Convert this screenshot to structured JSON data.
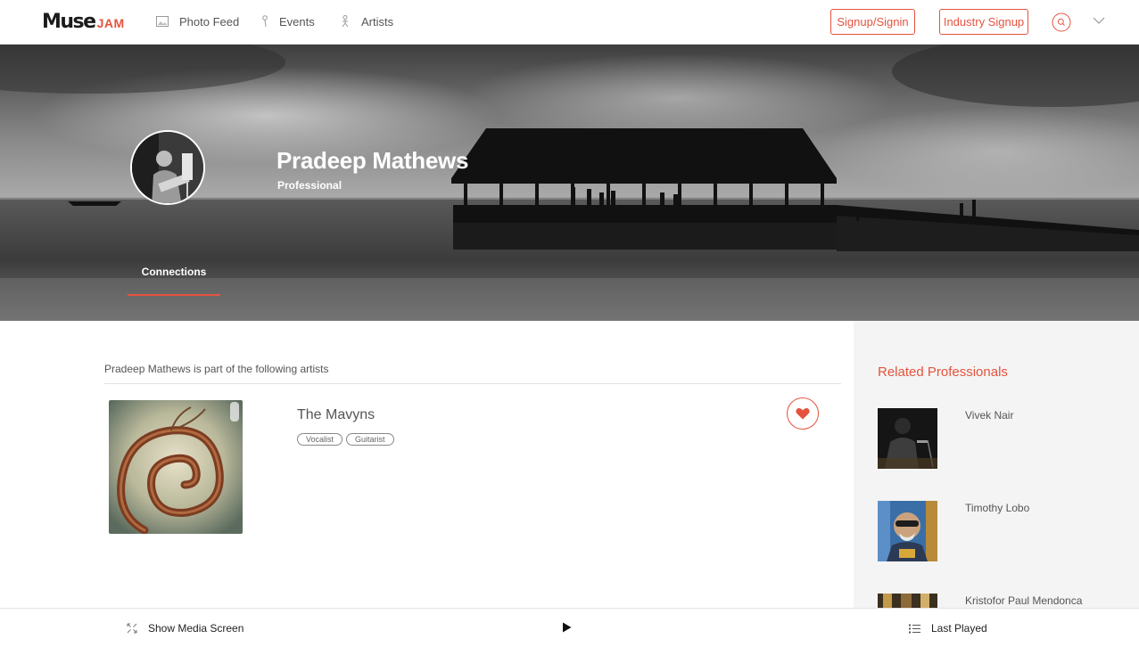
{
  "brand": {
    "muse": "Muse",
    "jam": "JAM",
    "accent": "#e5533d"
  },
  "nav": {
    "links": [
      {
        "label": "Photo Feed",
        "icon": "photo-icon"
      },
      {
        "label": "Events",
        "icon": "microphone-icon"
      },
      {
        "label": "Artists",
        "icon": "artist-icon"
      }
    ],
    "signup_signin": "Signup/Signin",
    "industry_signup": "Industry Signup",
    "search_icon": "search-icon",
    "menu_icon": "chevron-down-icon"
  },
  "profile": {
    "name": "Pradeep Mathews",
    "role": "Professional",
    "tabs": [
      {
        "label": "Connections",
        "active": true
      }
    ]
  },
  "main": {
    "heading": "Pradeep Mathews is part of the following artists",
    "artists": [
      {
        "name": "The Mavyns",
        "tags": [
          "Vocalist",
          "Guitarist"
        ],
        "liked": true
      }
    ]
  },
  "sidebar": {
    "title": "Related Professionals",
    "items": [
      {
        "name": "Vivek Nair"
      },
      {
        "name": "Timothy Lobo"
      },
      {
        "name": "Kristofor Paul Mendonca"
      }
    ]
  },
  "player": {
    "show_media": "Show Media Screen",
    "play_icon": "play-icon",
    "last_played": "Last Played"
  }
}
